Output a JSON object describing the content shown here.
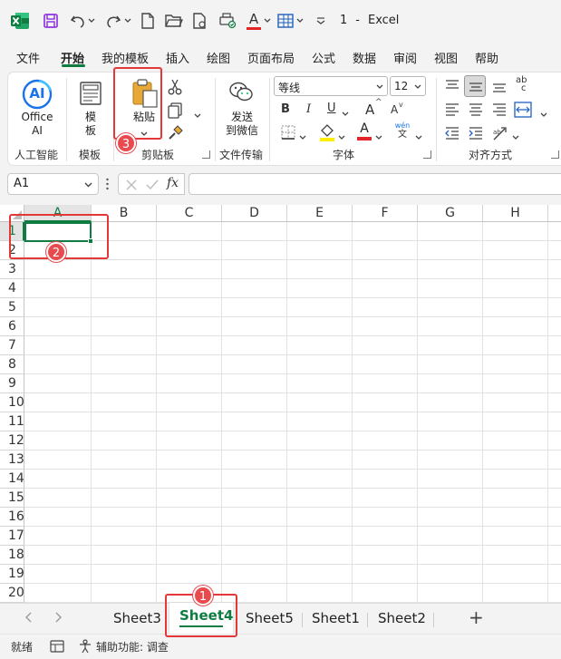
{
  "title_bar": {
    "doc_name": "1",
    "sep": "-",
    "app_name": "Excel",
    "font_color_letter": "A"
  },
  "menu_tabs": [
    "文件",
    "开始",
    "我的模板",
    "插入",
    "绘图",
    "页面布局",
    "公式",
    "数据",
    "审阅",
    "视图",
    "帮助"
  ],
  "ribbon": {
    "office_ai_label_1": "Office",
    "office_ai_label_2": "AI",
    "ai_icon_text": "AI",
    "group_ai": "人工智能",
    "template_label_1": "模",
    "template_label_2": "板",
    "group_template": "模板",
    "paste_label": "粘贴",
    "group_clipboard": "剪贴板",
    "send_wechat_1": "发送",
    "send_wechat_2": "到微信",
    "group_file_transfer": "文件传输",
    "font_name": "等线",
    "font_size": "12",
    "bold": "B",
    "italic": "I",
    "underline": "U",
    "grow_font": "A",
    "shrink_font": "A",
    "font_color": "A",
    "phonetic_top": "wén",
    "phonetic_bottom": "文",
    "group_font": "字体",
    "group_alignment": "对齐方式",
    "wrap_top": "ab",
    "wrap_bottom": "c"
  },
  "formula_bar": {
    "name_box": "A1",
    "fx_label": "fx",
    "formula_value": ""
  },
  "columns": [
    "A",
    "B",
    "C",
    "D",
    "E",
    "F",
    "G",
    "H"
  ],
  "rows": [
    "1",
    "2",
    "3",
    "4",
    "5",
    "6",
    "7",
    "8",
    "9",
    "10",
    "11",
    "12",
    "13",
    "14",
    "15",
    "16",
    "17",
    "18",
    "19",
    "20"
  ],
  "sheets": [
    "Sheet3",
    "Sheet4",
    "Sheet5",
    "Sheet1",
    "Sheet2"
  ],
  "active_sheet": "Sheet4",
  "add_sheet": "+",
  "status": {
    "ready": "就绪",
    "accessibility": "辅助功能: 调查"
  },
  "badges": {
    "b1": "1",
    "b2": "2",
    "b3": "3"
  },
  "colors": {
    "accent": "#107c41",
    "highlight": "#e3373a",
    "badge": "#e84a4e"
  }
}
